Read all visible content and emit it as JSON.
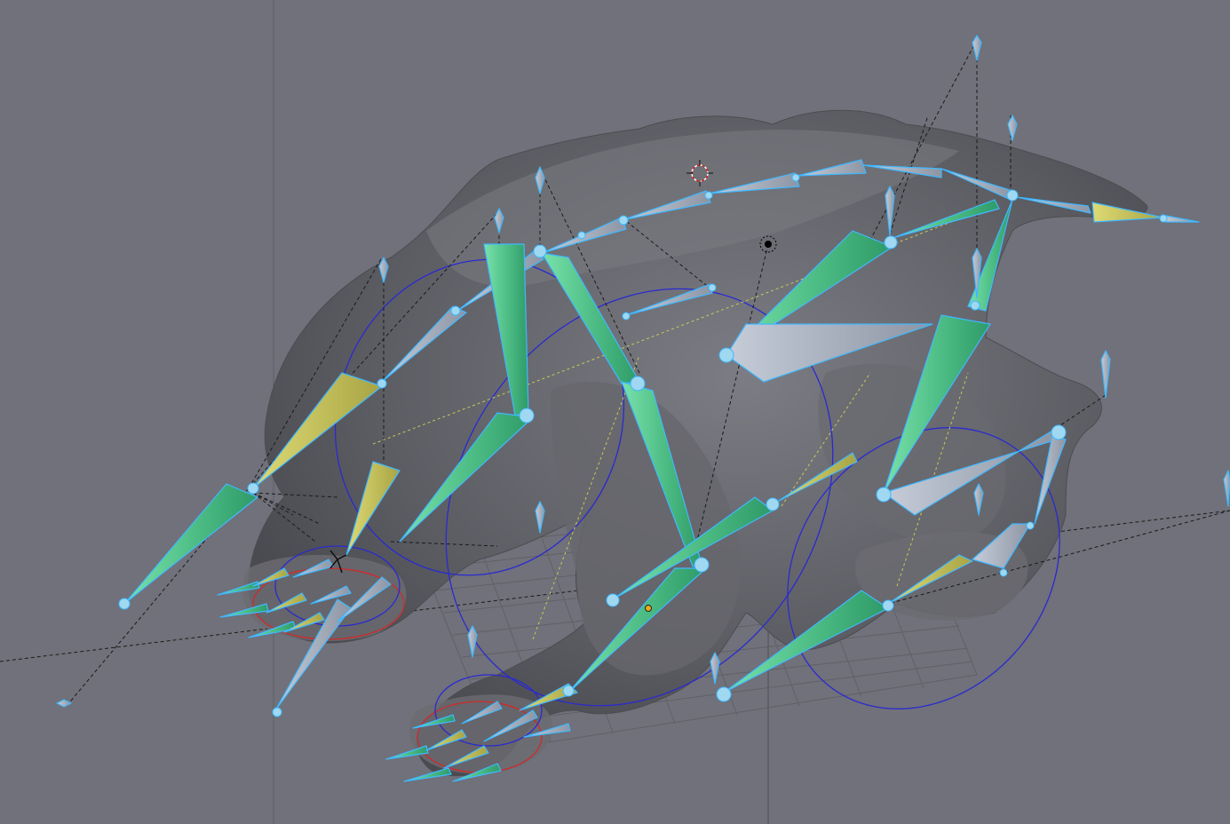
{
  "viewport": {
    "background_color": "#70717a",
    "mesh_color": "#5c5d63",
    "bone_green": "#55c98f",
    "bone_yellow": "#c7c35a",
    "bone_grey": "#9ea7b7",
    "bone_outline": "#3fb8ff",
    "ik_circle_blue": "#2a2ad0",
    "ik_circle_red": "#d02a2a",
    "grid_color": "#5a5a60"
  },
  "icons": {
    "cursor": "3d-cursor-icon",
    "light": "lamp-icon",
    "origin": "object-origin-icon"
  }
}
